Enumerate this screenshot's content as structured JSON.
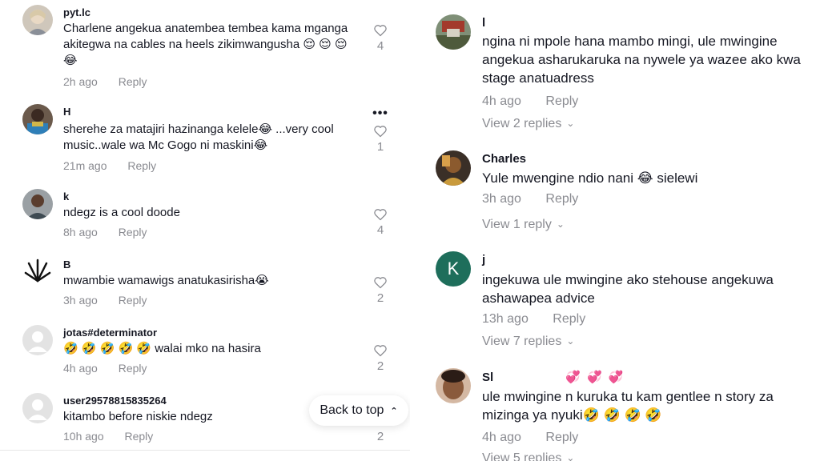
{
  "left_comments": [
    {
      "user": "pyt.lc",
      "text": "Charlene angekua anatembea tembea kama mganga akitegwa na cables na heels zikimwangusha 😌 😌 😌 😂",
      "time": "2h ago",
      "reply": "Reply",
      "likes": "4"
    },
    {
      "user": "H",
      "text": "sherehe za matajiri hazinanga kelele😂 ...very cool music..wale wa Mc Gogo ni maskini😂",
      "time": "21m ago",
      "reply": "Reply",
      "likes": "1",
      "more": "•••"
    },
    {
      "user": "k",
      "text": "ndegz is a cool doode",
      "time": "8h ago",
      "reply": "Reply",
      "likes": "4"
    },
    {
      "user": "B",
      "text": "mwambie wamawigs anatukasirisha😭",
      "time": "3h ago",
      "reply": "Reply",
      "likes": "2"
    },
    {
      "user": "jotas#determinator",
      "text": "🤣 🤣 🤣 🤣 🤣  walai mko na hasira",
      "time": "4h ago",
      "reply": "Reply",
      "likes": "2"
    },
    {
      "user": "user29578815835264",
      "text": "kitambo before niskie ndegz",
      "time": "10h ago",
      "reply": "Reply",
      "likes": "2"
    }
  ],
  "back_to_top": {
    "label": "Back to top",
    "icon": "⌃"
  },
  "right_comments": [
    {
      "user": "l",
      "text": "ngina ni mpole hana mambo mingi, ule mwingine angekua asharukaruka na nywele ya wazee ako kwa stage anatuadress",
      "time": "4h ago",
      "reply": "Reply",
      "view": "View 2 replies"
    },
    {
      "user": "Charles",
      "text": "Yule mwengine ndio nani 😂  sielewi",
      "time": "3h ago",
      "reply": "Reply",
      "view": "View 1 reply"
    },
    {
      "user": "j",
      "avatar_letter": "K",
      "text": "ingekuwa ule mwingine ako stehouse angekuwa ashawapea advice",
      "time": "13h ago",
      "reply": "Reply",
      "view": "View 7 replies"
    },
    {
      "user": "Sl",
      "user_suffix": "💞 💞 💞",
      "text": "ule mwingine n kuruka tu kam gentlee n story za mizinga ya nyuki🤣 🤣 🤣 🤣",
      "time": "4h ago",
      "reply": "Reply",
      "view": "View 5 replies"
    }
  ],
  "colors": {
    "muted": "#8a8b91",
    "text": "#161823",
    "avatar_k": "#1e6e5b"
  }
}
